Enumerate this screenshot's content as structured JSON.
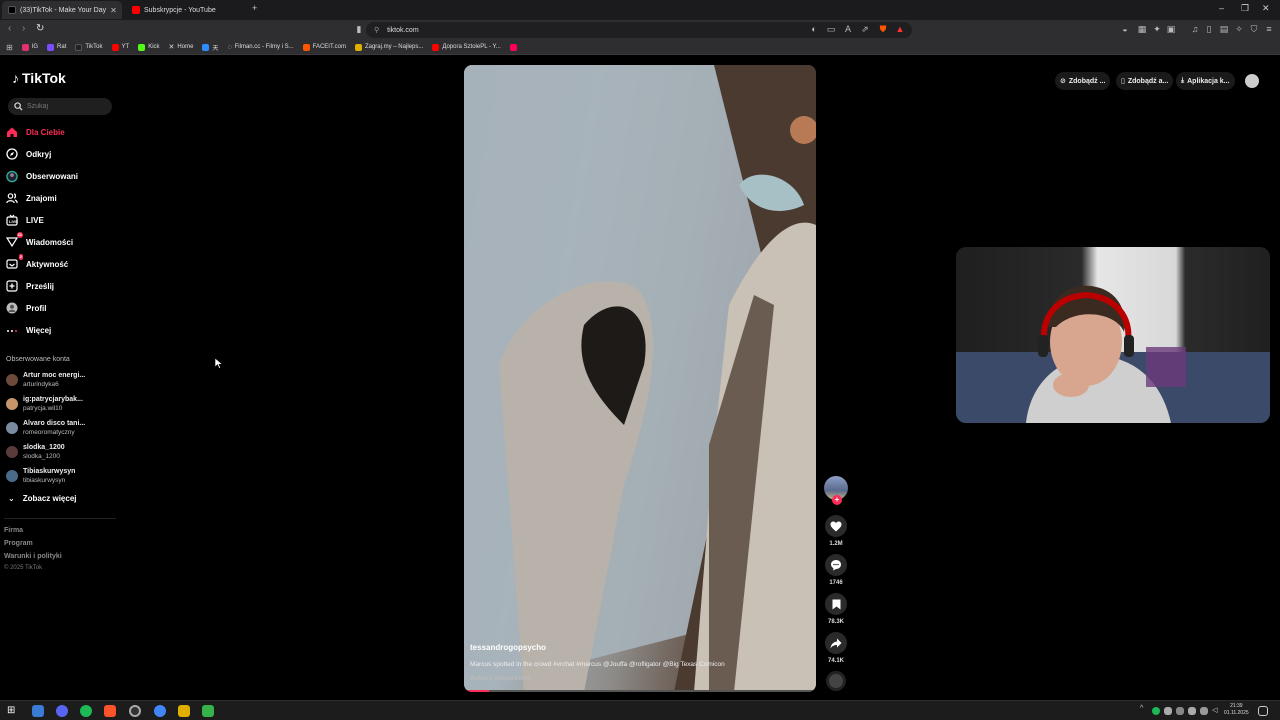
{
  "browser": {
    "tabs": [
      {
        "title": "(33)TikTok - Make Your Day",
        "active": true,
        "favicon_color": "#111111"
      },
      {
        "title": "Subskrypcje - YouTube",
        "active": false,
        "favicon_color": "#ff0000"
      }
    ],
    "url": "tiktok.com",
    "bookmarks": [
      {
        "label": "IG",
        "color": "#e1306c"
      },
      {
        "label": "Rat",
        "color": "#7b4dff"
      },
      {
        "label": "TikTok",
        "color": "#222222"
      },
      {
        "label": "YT",
        "color": "#ff0000"
      },
      {
        "label": "Kick",
        "color": "#53fc18"
      },
      {
        "label": "Home",
        "color": "#cccccc"
      },
      {
        "label": "天",
        "color": "#2d8cff"
      },
      {
        "label": "Filman.cc - Filmy i S...",
        "color": "#888888"
      },
      {
        "label": "FACEIT.com",
        "color": "#ff5500"
      },
      {
        "label": "Zagraj.my – Najleps...",
        "color": "#e0b000"
      },
      {
        "label": "Дорога SztolePL - Y...",
        "color": "#ff0000"
      },
      {
        "label": "",
        "color": "#ff0055"
      }
    ]
  },
  "tiktok": {
    "logo": "TikTok",
    "search_placeholder": "Szukaj",
    "nav": [
      {
        "label": "Dla Ciebie",
        "icon": "home-icon",
        "active": true
      },
      {
        "label": "Odkryj",
        "icon": "compass-icon"
      },
      {
        "label": "Obserwowani",
        "icon": "following-icon"
      },
      {
        "label": "Znajomi",
        "icon": "friends-icon"
      },
      {
        "label": "LIVE",
        "icon": "live-icon"
      },
      {
        "label": "Wiadomości",
        "icon": "messages-icon",
        "badge": "31"
      },
      {
        "label": "Aktywność",
        "icon": "activity-icon",
        "badge": "2"
      },
      {
        "label": "Prześlij",
        "icon": "upload-icon"
      },
      {
        "label": "Profil",
        "icon": "profile-icon"
      },
      {
        "label": "Więcej",
        "icon": "more-icon"
      }
    ],
    "following_title": "Obserwowane konta",
    "following": [
      {
        "name": "Artur moc energi...",
        "handle": "arturindyka6",
        "color": "#6b4a3a"
      },
      {
        "name": "ig:patrycjarybak...",
        "handle": "patrycja.wil10",
        "color": "#c8956a"
      },
      {
        "name": "Alvaro disco tani...",
        "handle": "romeoromatyczny",
        "color": "#7a8aa0"
      },
      {
        "name": "slodka_1200",
        "handle": "slodka_1200",
        "color": "#5a3a3a"
      },
      {
        "name": "Tibiaskurwysyn",
        "handle": "tibiaskurwysyn",
        "color": "#4a6a8a"
      }
    ],
    "see_more": "Zobacz więcej",
    "footer": [
      "Firma",
      "Program",
      "Warunki i polityki"
    ],
    "copyright": "© 2025 TikTok",
    "top_buttons": [
      "Zdobądź ...",
      "Zdobądź a...",
      "Aplikacja k..."
    ],
    "video": {
      "author": "tessandrogopsycho",
      "caption": "Marcus spotted in the crowd #vrchat #marcus @Jouffa @rofligator @Big Texas Comicon",
      "translate": "Zobacz tłumaczenie",
      "progress": 0.07
    },
    "actions": {
      "likes": "1.2M",
      "comments": "1746",
      "saves": "78.3K",
      "shares": "74.1K"
    }
  },
  "taskbar": {
    "time": "21:39",
    "date": "01.11.2025"
  }
}
